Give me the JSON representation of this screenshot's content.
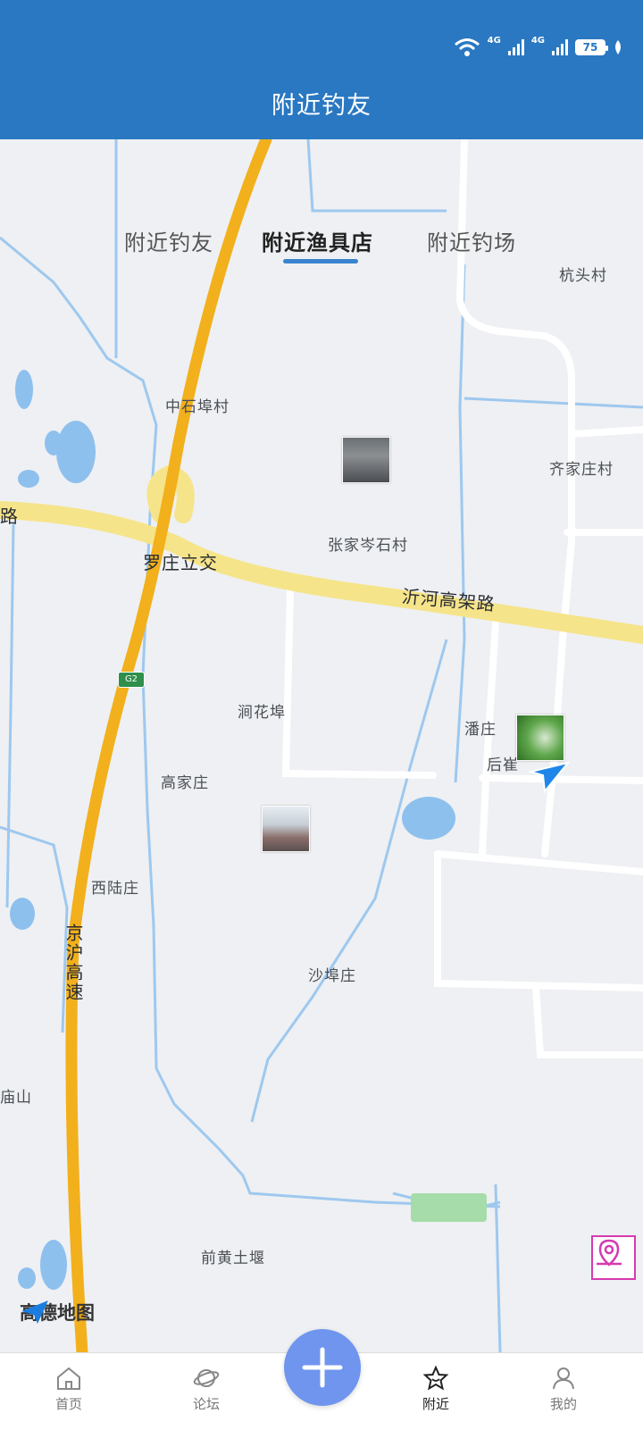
{
  "status_bar": {
    "net1": "4G",
    "net2": "4G",
    "battery": "75"
  },
  "header": {
    "title": "附近钓友"
  },
  "tabs": [
    {
      "label": "附近钓友"
    },
    {
      "label": "附近渔具店"
    },
    {
      "label": "附近钓场"
    }
  ],
  "map": {
    "labels": {
      "hangtou": "杭头村",
      "zhongshifu": "中石埠村",
      "qijiazhuang": "齐家庄村",
      "lu": "路",
      "zhangjia": "张家岑石村",
      "luozhuang": "罗庄立交",
      "yihe": "沂河高架路",
      "jianhuafu": "涧花埠",
      "panzhuang": "潘庄",
      "houcui": "后崔",
      "gaojiazhuang": "高家庄",
      "xilu": "西陆庄",
      "jinghu": "京沪高速",
      "shafuzhuang": "沙埠庄",
      "miaoshan": "庙山",
      "qianhuang": "前黄土堰"
    },
    "highway_shield": "G2",
    "provider": "高德地图"
  },
  "nav": {
    "home": "首页",
    "forum": "论坛",
    "nearby": "附近",
    "mine": "我的"
  }
}
